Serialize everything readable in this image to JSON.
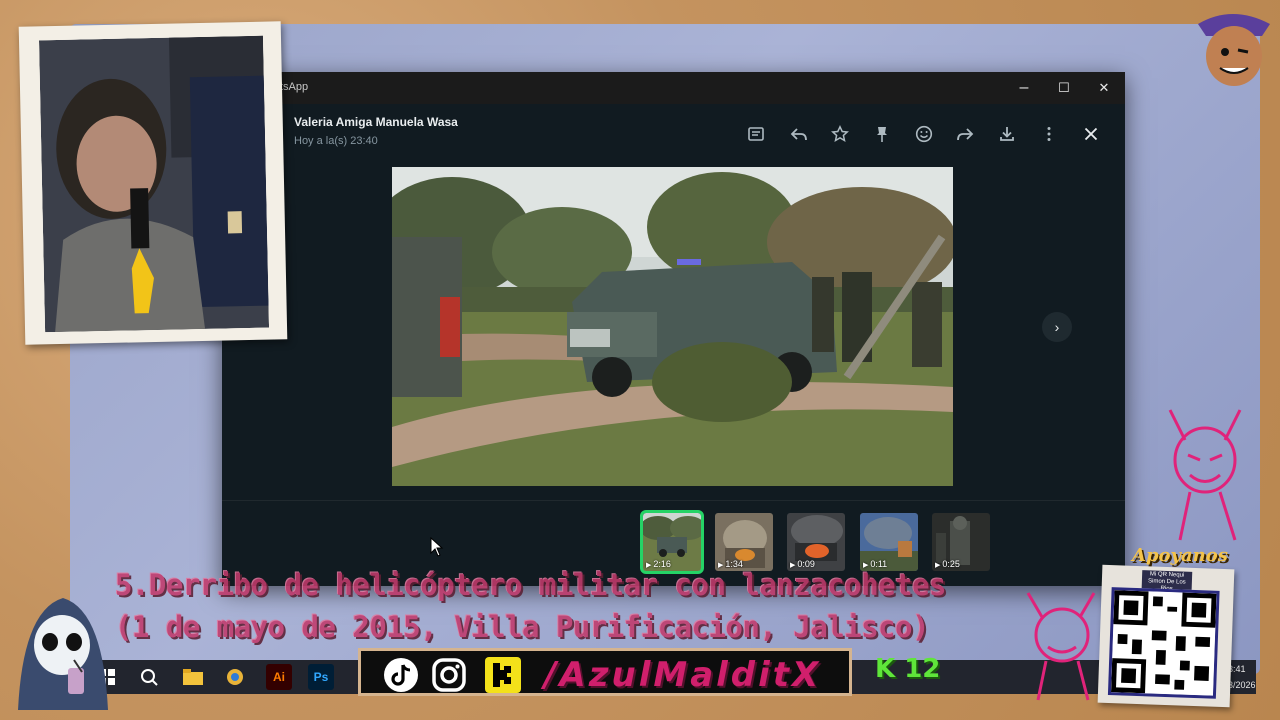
{
  "window": {
    "app_title": "tsApp",
    "minimize_glyph": "–",
    "maximize_glyph": "☐",
    "close_glyph": "✕"
  },
  "message": {
    "sender": "Valeria Amiga Manuela Wasa",
    "timestamp": "Hoy a la(s) 23:40"
  },
  "toolbar": {
    "icons": [
      "message-icon",
      "reply-icon",
      "star-icon",
      "pin-icon",
      "emoji-icon",
      "forward-icon",
      "download-icon",
      "more-icon",
      "close-icon"
    ]
  },
  "thumbnails": [
    {
      "duration": "2:16",
      "active": true
    },
    {
      "duration": "1:34",
      "active": false
    },
    {
      "duration": "0:09",
      "active": false
    },
    {
      "duration": "0:11",
      "active": false
    },
    {
      "duration": "0:25",
      "active": false
    }
  ],
  "overlay": {
    "caption_line1": "5.Derribo de helicóptero militar con lanzacohetes",
    "caption_line2": "(1 de mayo de 2015, Villa Purificación, Jalisco)",
    "handle": "/AzulMalditX",
    "kick_badge": "K 12",
    "apoyanos": "Apoyanos",
    "qr_label": "Mi QR Nequi Simon De Los Rios"
  },
  "taskbar": {
    "clock_time": "3:41",
    "clock_date": "3/2026"
  },
  "colors": {
    "accent": "#25d366",
    "window_bg": "#111b21",
    "caption": "#c23a6c"
  }
}
